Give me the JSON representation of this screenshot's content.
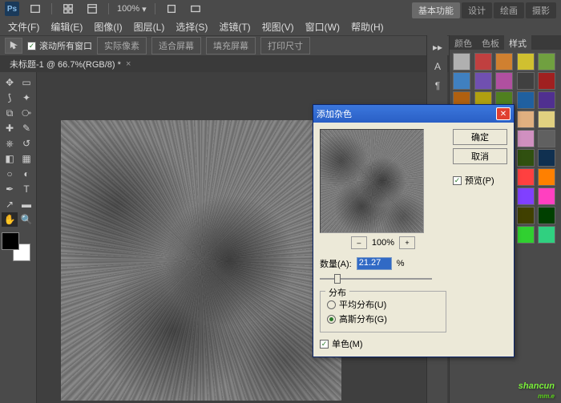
{
  "app": {
    "logo": "Ps"
  },
  "titlebar": {
    "zoom": "100%"
  },
  "workspace_tabs": [
    "基本功能",
    "设计",
    "绘画",
    "摄影"
  ],
  "workspace_active": 0,
  "menubar": [
    "文件(F)",
    "编辑(E)",
    "图像(I)",
    "图层(L)",
    "选择(S)",
    "滤镜(T)",
    "视图(V)",
    "窗口(W)",
    "帮助(H)"
  ],
  "optbar": {
    "scroll_all": "滚动所有窗口",
    "btns": [
      "实际像素",
      "适合屏幕",
      "填充屏幕",
      "打印尺寸"
    ]
  },
  "doctab": {
    "label": "未标题-1 @ 66.7%(RGB/8) *"
  },
  "right_panel": {
    "tabs": [
      "颜色",
      "色板",
      "样式"
    ],
    "active": 2,
    "char_tab": "A"
  },
  "dialog": {
    "title": "添加杂色",
    "ok": "确定",
    "cancel": "取消",
    "preview_check": "预览(P)",
    "zoom_pct": "100%",
    "amount_label": "数量(A):",
    "amount_value": "21.27",
    "amount_unit": "%",
    "dist_group": "分布",
    "dist_uniform": "平均分布(U)",
    "dist_gaussian": "高斯分布(G)",
    "mono": "单色(M)"
  },
  "watermark": {
    "main": "shancun",
    "sub": "mm.e"
  },
  "style_colors": [
    "#b0b0b0",
    "#c04040",
    "#d08030",
    "#d0c030",
    "#70a040",
    "#4080c0",
    "#7050b0",
    "#b050a0",
    "#404040",
    "#a02020",
    "#b06010",
    "#b0a010",
    "#508020",
    "#2060a0",
    "#503090",
    "#903080",
    "#e0e0e0",
    "#e08080",
    "#e0b080",
    "#e0d080",
    "#a0d080",
    "#80b0e0",
    "#a090d0",
    "#d090c0",
    "#606060",
    "#802020",
    "#804000",
    "#806000",
    "#305010",
    "#103050",
    "#301060",
    "#601050",
    "#ffffff",
    "#ff4040",
    "#ff8000",
    "#ffff00",
    "#40ff40",
    "#4080ff",
    "#8040ff",
    "#ff40c0",
    "#000000",
    "#400000",
    "#402000",
    "#404000",
    "#004000",
    "#000040",
    "#200040",
    "#400030",
    "#30d030",
    "#30d080",
    "#30d0d0",
    "#3080d0",
    "#d0d030"
  ]
}
